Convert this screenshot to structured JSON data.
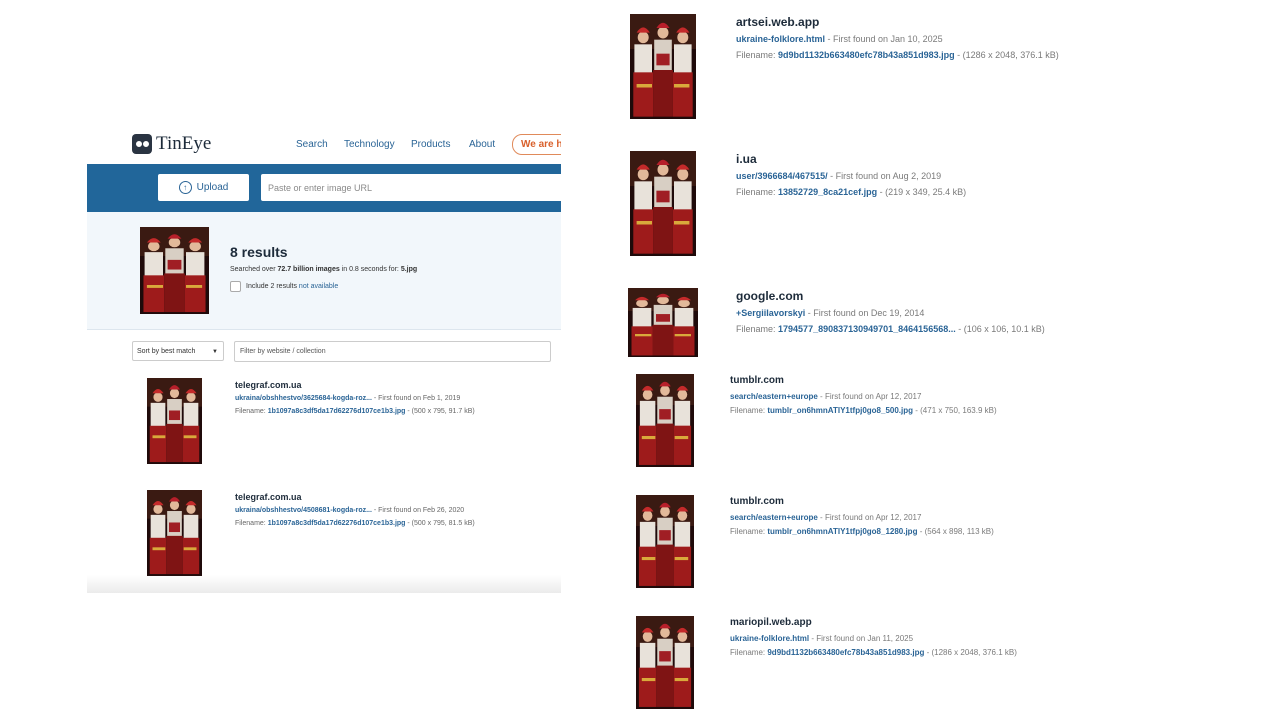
{
  "header": {
    "logo_text": "TinEye",
    "nav": [
      "Search",
      "Technology",
      "Products",
      "About"
    ],
    "hire_label": "We are hi"
  },
  "search": {
    "upload_label": "Upload",
    "url_placeholder": "Paste or enter image URL"
  },
  "summary": {
    "results_title": "8 results",
    "searched_prefix": "Searched over ",
    "searched_count": "72.7 billion images",
    "searched_mid": " in 0.8 seconds for: ",
    "searched_file": "5.jpg",
    "include_label": "Include 2 results ",
    "include_link": "not available"
  },
  "controls": {
    "sort_label": "Sort by best match",
    "filter_placeholder": "Filter by website / collection"
  },
  "left_results": [
    {
      "site": "telegraf.com.ua",
      "page": "ukraina/obshhestvo/3625684-kogda-roz...",
      "found": " - First found on Feb 1, 2019",
      "filename_label": "Filename: ",
      "filename": "1b1097a8c3df5da17d62276d107ce1b3.jpg",
      "meta": " - (500 x 795, 91.7 kB)"
    },
    {
      "site": "telegraf.com.ua",
      "page": "ukraina/obshhestvo/4508681-kogda-roz...",
      "found": " - First found on Feb 26, 2020",
      "filename_label": "Filename: ",
      "filename": "1b1097a8c3df5da17d62276d107ce1b3.jpg",
      "meta": " - (500 x 795, 81.5 kB)"
    }
  ],
  "right_results": [
    {
      "site": "artsei.web.app",
      "page": "ukraine-folklore.html",
      "found": " - First found on Jan 10, 2025",
      "filename_label": "Filename: ",
      "filename": "9d9bd1132b663480efc78b43a851d983.jpg",
      "meta": " - (1286 x 2048, 376.1 kB)"
    },
    {
      "site": "i.ua",
      "page": "user/3966684/467515/",
      "found": " - First found on Aug 2, 2019",
      "filename_label": "Filename: ",
      "filename": "13852729_8ca21cef.jpg",
      "meta": " - (219 x 349, 25.4 kB)"
    },
    {
      "site": "google.com",
      "page": "+SergiiIavorskyi",
      "found": " - First found on Dec 19, 2014",
      "filename_label": "Filename: ",
      "filename": "1794577_890837130949701_8464156568...",
      "meta": " - (106 x 106, 10.1 kB)"
    },
    {
      "site": "tumblr.com",
      "page": "search/eastern+europe",
      "found": " - First found on Apr 12, 2017",
      "filename_label": "Filename: ",
      "filename": "tumblr_on6hmnATIY1tfpj0go8_500.jpg",
      "meta": " - (471 x 750, 163.9 kB)"
    },
    {
      "site": "tumblr.com",
      "page": "search/eastern+europe",
      "found": " - First found on Apr 12, 2017",
      "filename_label": "Filename: ",
      "filename": "tumblr_on6hmnATIY1tfpj0go8_1280.jpg",
      "meta": " - (564 x 898, 113 kB)"
    },
    {
      "site": "mariopil.web.app",
      "page": "ukraine-folklore.html",
      "found": " - First found on Jan 11, 2025",
      "filename_label": "Filename: ",
      "filename": "9d9bd1132b663480efc78b43a851d983.jpg",
      "meta": " - (1286 x 2048, 376.1 kB)"
    }
  ],
  "icons": {
    "logo": "tineye-logo-icon",
    "upload": "upload-arrow-icon",
    "dropdown": "chevron-down-icon"
  },
  "colors": {
    "accent": "#21669a",
    "link": "#2a6496",
    "hire": "#d9602b"
  }
}
